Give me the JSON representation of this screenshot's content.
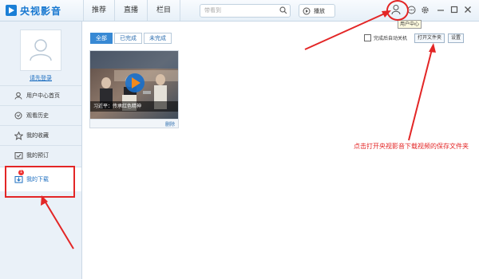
{
  "app": {
    "title": "央视影音"
  },
  "nav": {
    "tabs": [
      {
        "label": "推荐"
      },
      {
        "label": "直播"
      },
      {
        "label": "栏目"
      }
    ]
  },
  "search": {
    "placeholder": "带看到"
  },
  "toolbar": {
    "play_label": "播放",
    "user_center_tooltip": "用户中心"
  },
  "sidebar": {
    "login_link": "请先登录",
    "items": [
      {
        "label": "用户中心首页",
        "icon": "user-icon"
      },
      {
        "label": "观看历史",
        "icon": "history-icon"
      },
      {
        "label": "我的收藏",
        "icon": "star-icon"
      },
      {
        "label": "我的预订",
        "icon": "calendar-icon"
      },
      {
        "label": "我的下载",
        "icon": "download-icon",
        "active": true,
        "badge": "1"
      }
    ]
  },
  "filters": {
    "tabs": [
      {
        "label": "全部",
        "active": true
      },
      {
        "label": "已完成"
      },
      {
        "label": "未完成"
      }
    ]
  },
  "options": {
    "auto_shutdown_label": "完成后自动关机",
    "open_folder_label": "打开文件夹",
    "settings_label": "设置"
  },
  "download_item": {
    "caption": "习近平：传承红色精神",
    "delete_label": "删除"
  },
  "annotation": {
    "text": "点击打开央视影音下载视频的保存文件夹"
  },
  "colors": {
    "accent": "#1e6fc0",
    "annotation": "#e32626"
  }
}
